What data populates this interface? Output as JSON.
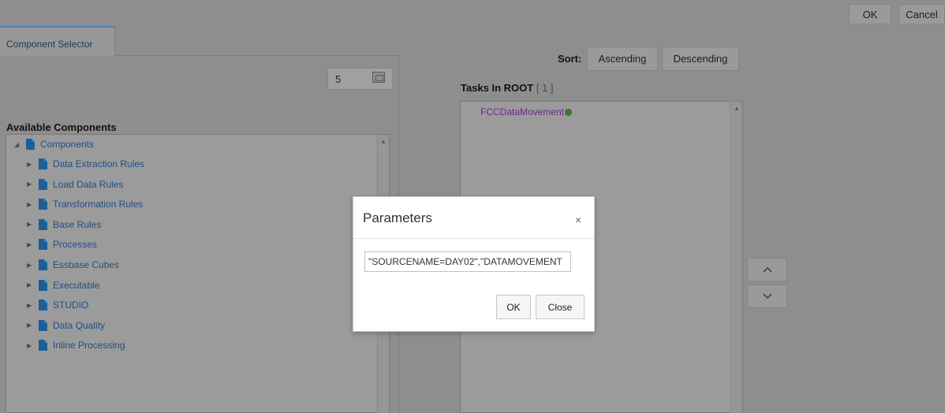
{
  "top_actions": {
    "ok": "OK",
    "cancel": "Cancel"
  },
  "tab": {
    "label": "Component Selector"
  },
  "counter": {
    "value": "5",
    "icon": "calendar-icon"
  },
  "available": {
    "label": "Available Components",
    "root": "Components",
    "items": [
      "Data Extraction Rules",
      "Load Data Rules",
      "Transformation Rules",
      "Base Rules",
      "Processes",
      "Essbase Cubes",
      "Executable",
      "STUDIO",
      "Data Quality",
      "Inline Processing"
    ]
  },
  "sort": {
    "label": "Sort:",
    "ascending": "Ascending",
    "descending": "Descending"
  },
  "tasks": {
    "label": "Tasks In ROOT",
    "count": "[ 1 ]",
    "items": [
      "FCCDataMovement"
    ]
  },
  "move": {
    "up": "^",
    "down": "v"
  },
  "dialog": {
    "title": "Parameters",
    "close_glyph": "×",
    "input_value": "\"SOURCENAME=DAY02\",\"DATAMOVEMENT",
    "ok": "OK",
    "close": "Close"
  }
}
